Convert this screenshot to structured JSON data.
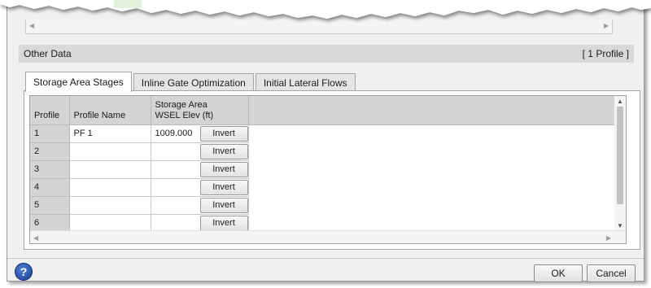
{
  "other_data": {
    "title": "Other Data",
    "profile_count": "[ 1 Profile ]"
  },
  "tabs": [
    {
      "label": "Storage Area Stages",
      "active": true
    },
    {
      "label": "Inline Gate Optimization",
      "active": false
    },
    {
      "label": "Initial Lateral Flows",
      "active": false
    }
  ],
  "grid": {
    "headers": {
      "profile": "Profile",
      "profile_name": "Profile Name",
      "storage_line1": "Storage Area",
      "storage_line2": "WSEL Elev (ft)"
    },
    "rows": [
      {
        "profile": "1",
        "name": "PF 1",
        "elev": "1009.000",
        "button": "Invert"
      },
      {
        "profile": "2",
        "name": "",
        "elev": "",
        "button": "Invert"
      },
      {
        "profile": "3",
        "name": "",
        "elev": "",
        "button": "Invert"
      },
      {
        "profile": "4",
        "name": "",
        "elev": "",
        "button": "Invert"
      },
      {
        "profile": "5",
        "name": "",
        "elev": "",
        "button": "Invert"
      },
      {
        "profile": "6",
        "name": "",
        "elev": "",
        "button": "Invert"
      }
    ]
  },
  "buttons": {
    "ok": "OK",
    "cancel": "Cancel",
    "help": "?"
  },
  "icons": {
    "help": "help-icon",
    "scroll_up": "scroll-up-arrow-icon",
    "scroll_down": "scroll-down-arrow-icon",
    "scroll_left": "scroll-left-arrow-icon",
    "scroll_right": "scroll-right-arrow-icon"
  },
  "colors": {
    "header_bg": "#d9d9d9",
    "dialog_bg": "#f0f0f0",
    "help_blue": "#1c3f95"
  }
}
